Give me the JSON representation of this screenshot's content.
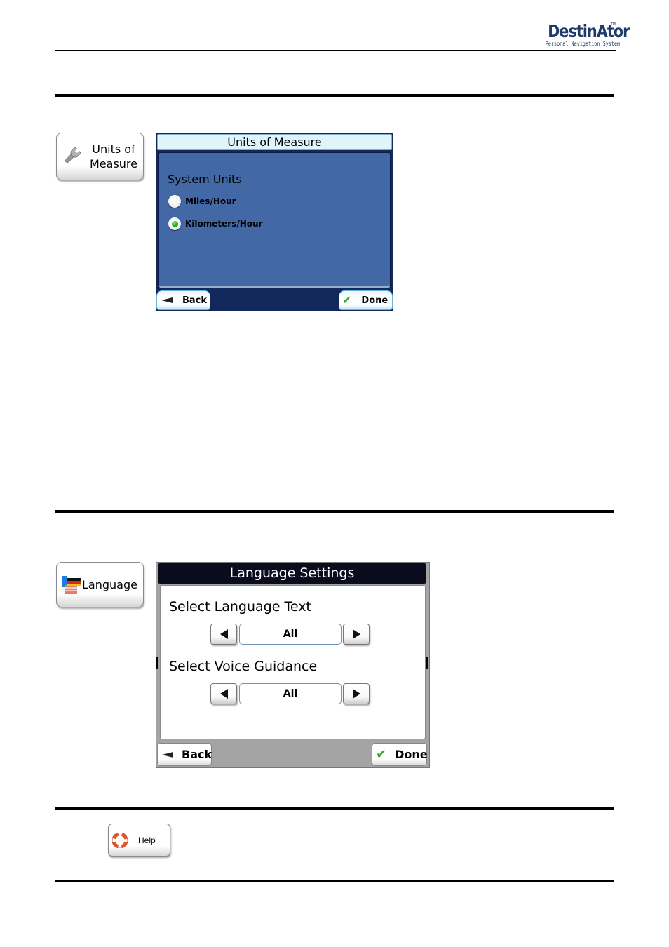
{
  "header": {
    "logo_main": "DestinAtor",
    "logo_tm": "TM",
    "logo_sub": "Personal Navigation System"
  },
  "units_section": {
    "button_label_line1": "Units of",
    "button_label_line2": "Measure",
    "button_icon": "wrench-icon",
    "dialog": {
      "title": "Units of Measure",
      "heading": "System Units",
      "options": [
        {
          "label": "Miles/Hour",
          "selected": false
        },
        {
          "label": "Kilometers/Hour",
          "selected": true
        }
      ],
      "back_label": "Back",
      "done_label": "Done",
      "colors": {
        "frame": "#13285a",
        "panel": "#4368a6",
        "title_bg": "#dff4fb"
      }
    }
  },
  "language_section": {
    "button_label": "Language",
    "button_icon": "flags-icon",
    "dialog": {
      "title": "Language Settings",
      "text_heading": "Select Language Text",
      "text_value": "All",
      "voice_heading": "Select Voice Guidance",
      "voice_value": "All",
      "back_label": "Back",
      "done_label": "Done",
      "colors": {
        "title_bg": "#0b0b1e",
        "frame": "#a4a4a4",
        "panel": "#ffffff"
      }
    }
  },
  "help_section": {
    "button_label": "Help",
    "button_icon": "lifebuoy-icon"
  }
}
